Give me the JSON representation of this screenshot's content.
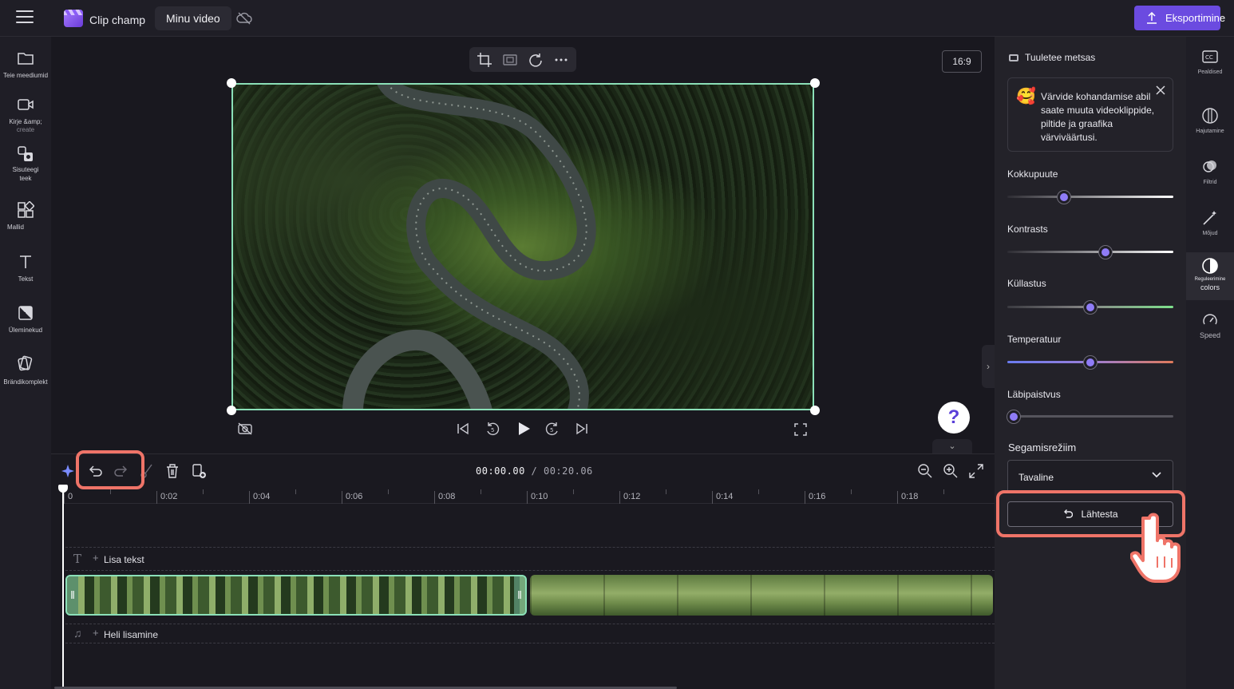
{
  "topbar": {
    "app_name": "Clip champ",
    "project_name": "Minu video",
    "export_label": "Eksportimine",
    "brand_color": "#6b4be0"
  },
  "sidebar": {
    "items": [
      {
        "label": "Teie meediumid",
        "icon": "folder-icon"
      },
      {
        "label": "Kirje &amp;",
        "label2": "create",
        "icon": "camera-icon"
      },
      {
        "label": "Sisuteegi",
        "label2": "teek",
        "icon": "content-library-icon"
      },
      {
        "label": "Mallid",
        "icon": "templates-icon"
      },
      {
        "label": "Tekst",
        "icon": "text-icon"
      },
      {
        "label": "Üleminekud",
        "icon": "transitions-icon"
      },
      {
        "label": "Brändikomplekt",
        "icon": "brand-kit-icon"
      }
    ]
  },
  "preview": {
    "aspect_ratio": "16:9",
    "help_label": "?"
  },
  "timeline": {
    "current_time": "00:00.00",
    "separator": " / ",
    "total_time": "00:20.06",
    "ticks": [
      "0",
      "0:02",
      "0:04",
      "0:06",
      "0:08",
      "0:10",
      "0:12",
      "0:14",
      "0:16",
      "0:18"
    ],
    "text_track_label": "Lisa tekst",
    "audio_track_label": "Heli lisamine"
  },
  "panel": {
    "clip_title": "Tuuletee metsas",
    "tip_text": "Värvide kohandamise abil saate muuta videoklippide, piltide ja graafika värviväärtusi.",
    "sliders": [
      {
        "label": "Kokkupuute",
        "value": 0.33
      },
      {
        "label": "Kontrasts",
        "value": 0.6
      },
      {
        "label": "Küllastus",
        "value": 0.5
      },
      {
        "label": "Temperatuur",
        "value": 0.5
      },
      {
        "label": "Läbipaistvus",
        "value": 0.0
      }
    ],
    "blend_label": "Segamisrežiim",
    "blend_value": "Tavaline",
    "reset_label": "Lähtesta"
  },
  "right_tabs": [
    {
      "label": "Pealdised",
      "icon": "captions-icon"
    },
    {
      "label": "Hajutamine",
      "icon": "fade-icon"
    },
    {
      "label": "Filtrid",
      "icon": "filters-icon"
    },
    {
      "label": "Mõjud",
      "icon": "effects-icon"
    },
    {
      "label": "Reguleerimine",
      "label2": "colors",
      "icon": "adjust-colors-icon"
    },
    {
      "label": "Speed",
      "icon": "speed-icon"
    }
  ],
  "highlight_color": "#ef7468"
}
